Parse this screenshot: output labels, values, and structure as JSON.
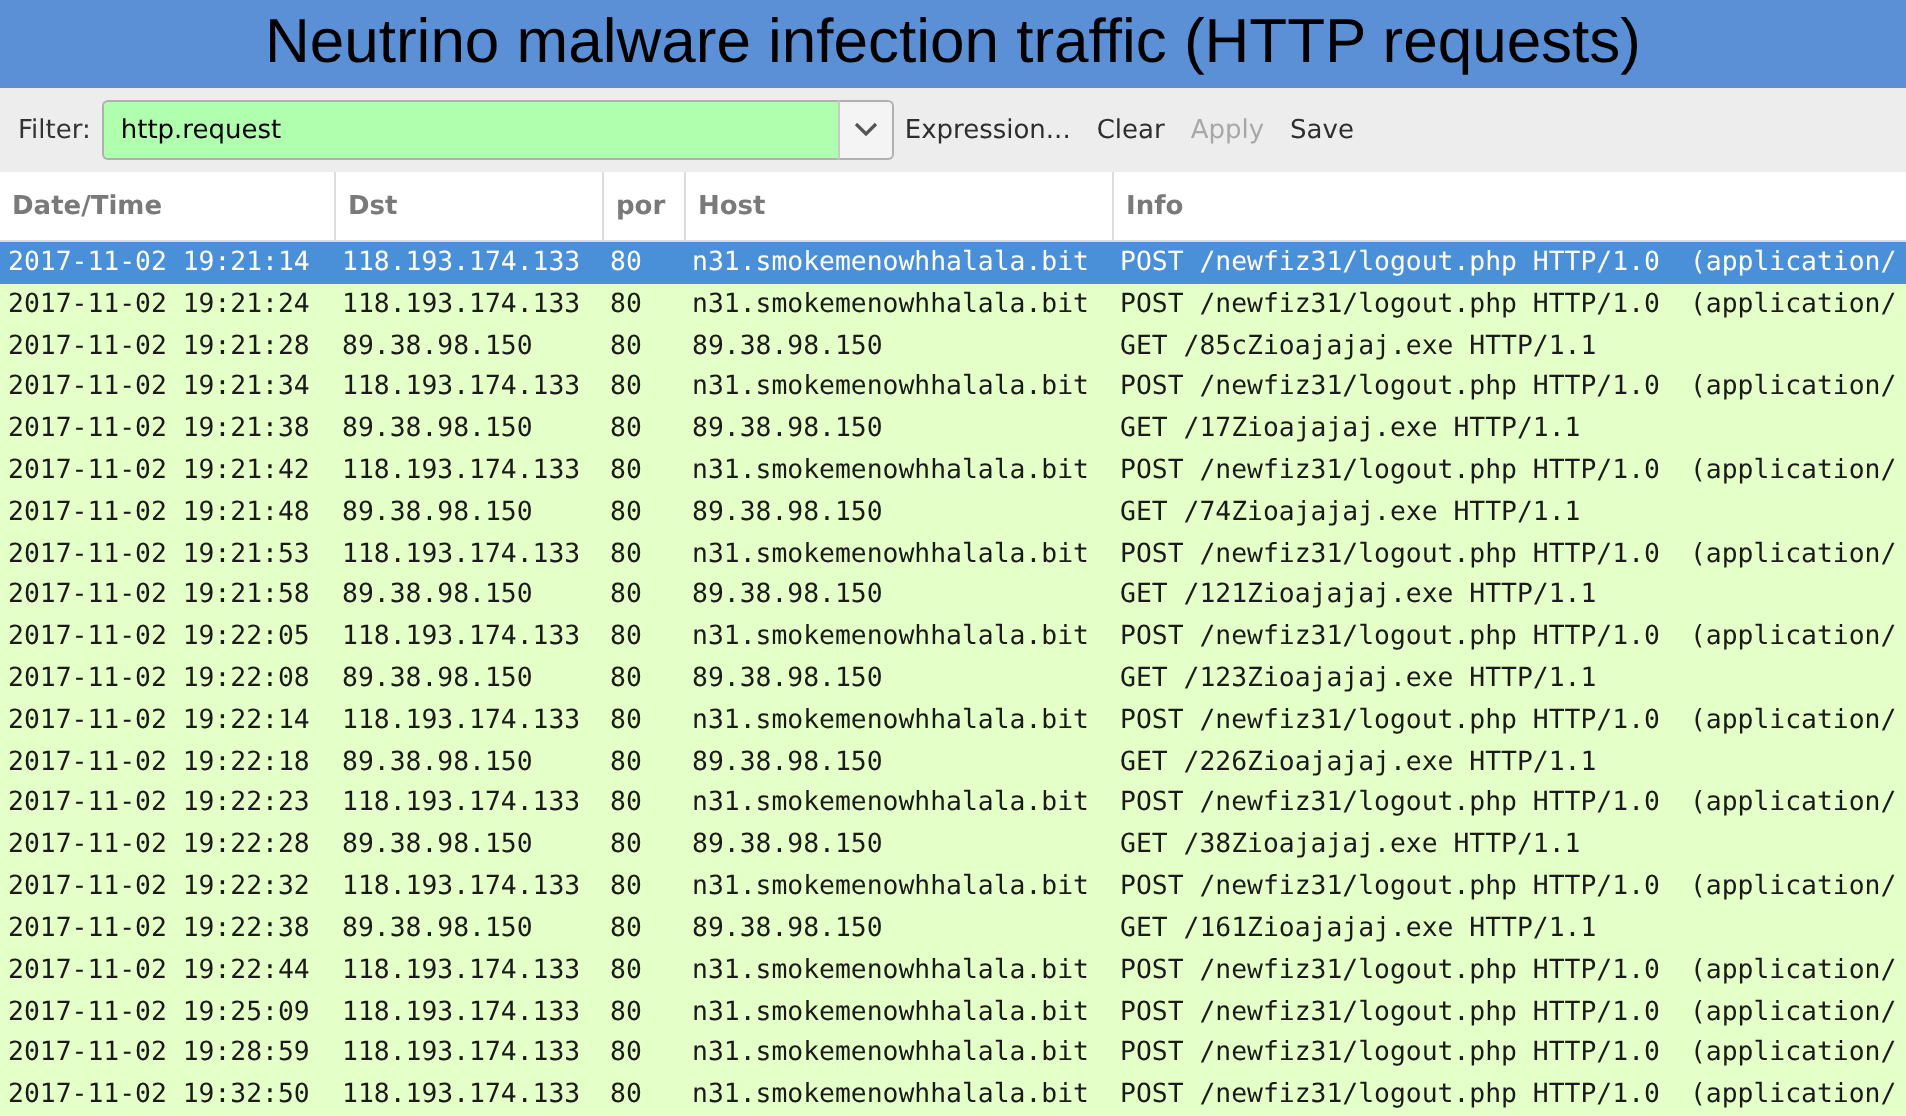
{
  "banner": {
    "title": "Neutrino malware infection traffic (HTTP requests)"
  },
  "filter": {
    "label": "Filter:",
    "value": "http.request",
    "buttons": [
      {
        "label": "Expression...",
        "disabled": false
      },
      {
        "label": "Clear",
        "disabled": false
      },
      {
        "label": "Apply",
        "disabled": true
      },
      {
        "label": "Save",
        "disabled": false
      }
    ]
  },
  "table": {
    "columns": [
      "Date/Time",
      "Dst",
      "por",
      "Host",
      "Info"
    ],
    "rows": [
      {
        "selected": true,
        "cells": [
          "2017-11-02 19:21:14",
          "118.193.174.133",
          "80",
          "n31.smokemenowhhalala.bit",
          "POST /newfiz31/logout.php HTTP/1.0",
          "(application/"
        ]
      },
      {
        "selected": false,
        "cells": [
          "2017-11-02 19:21:24",
          "118.193.174.133",
          "80",
          "n31.smokemenowhhalala.bit",
          "POST /newfiz31/logout.php HTTP/1.0",
          "(application/"
        ]
      },
      {
        "selected": false,
        "cells": [
          "2017-11-02 19:21:28",
          "89.38.98.150",
          "80",
          "89.38.98.150",
          "GET /85cZioajajaj.exe HTTP/1.1"
        ]
      },
      {
        "selected": false,
        "cells": [
          "2017-11-02 19:21:34",
          "118.193.174.133",
          "80",
          "n31.smokemenowhhalala.bit",
          "POST /newfiz31/logout.php HTTP/1.0",
          "(application/"
        ]
      },
      {
        "selected": false,
        "cells": [
          "2017-11-02 19:21:38",
          "89.38.98.150",
          "80",
          "89.38.98.150",
          "GET /17Zioajajaj.exe HTTP/1.1"
        ]
      },
      {
        "selected": false,
        "cells": [
          "2017-11-02 19:21:42",
          "118.193.174.133",
          "80",
          "n31.smokemenowhhalala.bit",
          "POST /newfiz31/logout.php HTTP/1.0",
          "(application/"
        ]
      },
      {
        "selected": false,
        "cells": [
          "2017-11-02 19:21:48",
          "89.38.98.150",
          "80",
          "89.38.98.150",
          "GET /74Zioajajaj.exe HTTP/1.1"
        ]
      },
      {
        "selected": false,
        "cells": [
          "2017-11-02 19:21:53",
          "118.193.174.133",
          "80",
          "n31.smokemenowhhalala.bit",
          "POST /newfiz31/logout.php HTTP/1.0",
          "(application/"
        ]
      },
      {
        "selected": false,
        "cells": [
          "2017-11-02 19:21:58",
          "89.38.98.150",
          "80",
          "89.38.98.150",
          "GET /121Zioajajaj.exe HTTP/1.1"
        ]
      },
      {
        "selected": false,
        "cells": [
          "2017-11-02 19:22:05",
          "118.193.174.133",
          "80",
          "n31.smokemenowhhalala.bit",
          "POST /newfiz31/logout.php HTTP/1.0",
          "(application/"
        ]
      },
      {
        "selected": false,
        "cells": [
          "2017-11-02 19:22:08",
          "89.38.98.150",
          "80",
          "89.38.98.150",
          "GET /123Zioajajaj.exe HTTP/1.1"
        ]
      },
      {
        "selected": false,
        "cells": [
          "2017-11-02 19:22:14",
          "118.193.174.133",
          "80",
          "n31.smokemenowhhalala.bit",
          "POST /newfiz31/logout.php HTTP/1.0",
          "(application/"
        ]
      },
      {
        "selected": false,
        "cells": [
          "2017-11-02 19:22:18",
          "89.38.98.150",
          "80",
          "89.38.98.150",
          "GET /226Zioajajaj.exe HTTP/1.1"
        ]
      },
      {
        "selected": false,
        "cells": [
          "2017-11-02 19:22:23",
          "118.193.174.133",
          "80",
          "n31.smokemenowhhalala.bit",
          "POST /newfiz31/logout.php HTTP/1.0",
          "(application/"
        ]
      },
      {
        "selected": false,
        "cells": [
          "2017-11-02 19:22:28",
          "89.38.98.150",
          "80",
          "89.38.98.150",
          "GET /38Zioajajaj.exe HTTP/1.1"
        ]
      },
      {
        "selected": false,
        "cells": [
          "2017-11-02 19:22:32",
          "118.193.174.133",
          "80",
          "n31.smokemenowhhalala.bit",
          "POST /newfiz31/logout.php HTTP/1.0",
          "(application/"
        ]
      },
      {
        "selected": false,
        "cells": [
          "2017-11-02 19:22:38",
          "89.38.98.150",
          "80",
          "89.38.98.150",
          "GET /161Zioajajaj.exe HTTP/1.1"
        ]
      },
      {
        "selected": false,
        "cells": [
          "2017-11-02 19:22:44",
          "118.193.174.133",
          "80",
          "n31.smokemenowhhalala.bit",
          "POST /newfiz31/logout.php HTTP/1.0",
          "(application/"
        ]
      },
      {
        "selected": false,
        "cells": [
          "2017-11-02 19:25:09",
          "118.193.174.133",
          "80",
          "n31.smokemenowhhalala.bit",
          "POST /newfiz31/logout.php HTTP/1.0",
          "(application/"
        ]
      },
      {
        "selected": false,
        "cells": [
          "2017-11-02 19:28:59",
          "118.193.174.133",
          "80",
          "n31.smokemenowhhalala.bit",
          "POST /newfiz31/logout.php HTTP/1.0",
          "(application/"
        ]
      },
      {
        "selected": false,
        "cells": [
          "2017-11-02 19:32:50",
          "118.193.174.133",
          "80",
          "n31.smokemenowhhalala.bit",
          "POST /newfiz31/logout.php HTTP/1.0",
          "(application/"
        ]
      }
    ]
  }
}
